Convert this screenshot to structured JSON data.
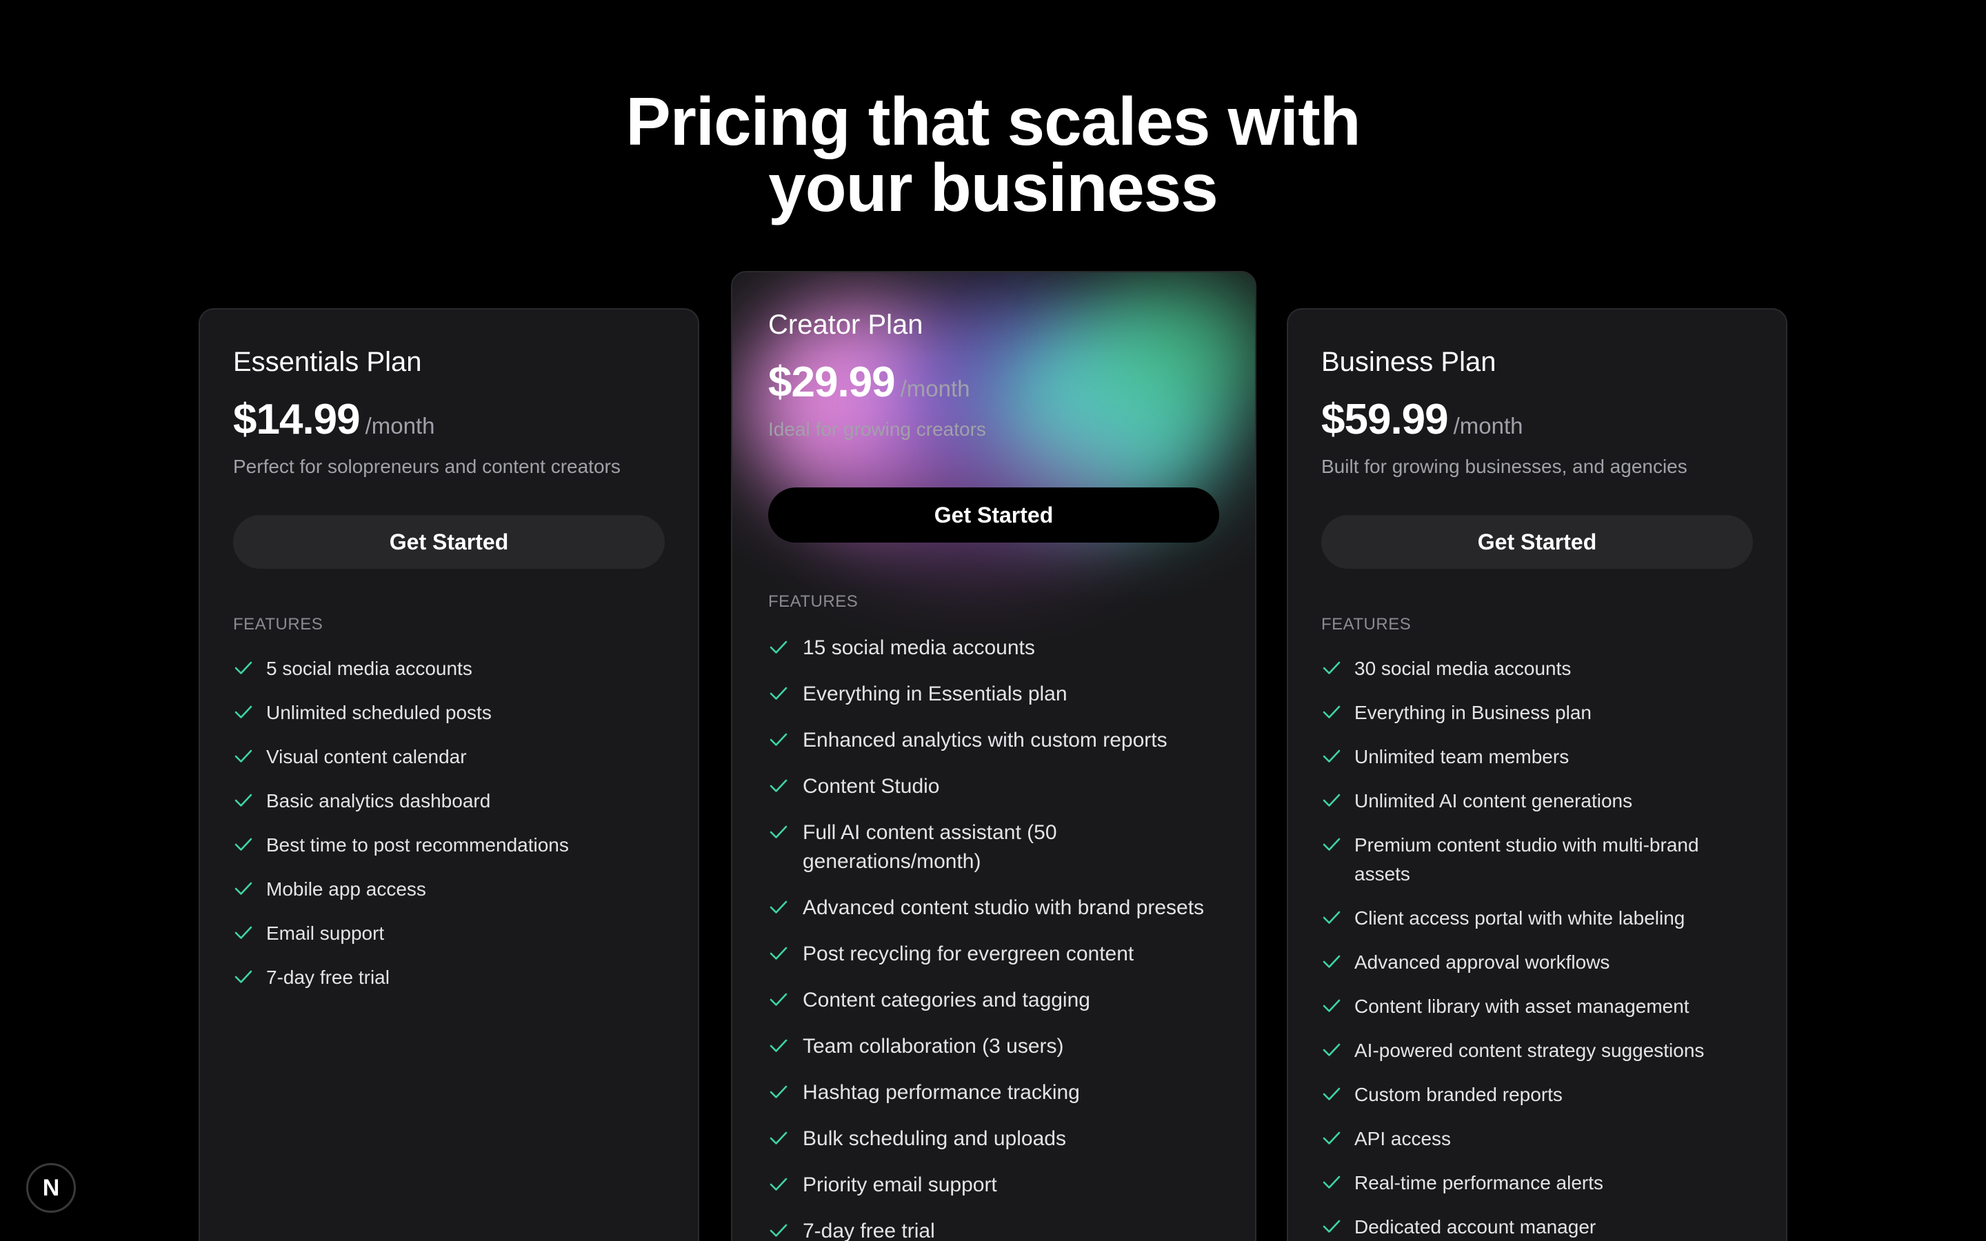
{
  "headline": {
    "line1": "Pricing that scales with",
    "line2": "your business"
  },
  "plans": [
    {
      "name": "Essentials Plan",
      "price": "$14.99",
      "period": "/month",
      "description": "Perfect for solopreneurs and content creators",
      "cta": "Get Started",
      "features_label": "FEATURES",
      "features": [
        "5 social media accounts",
        "Unlimited scheduled posts",
        "Visual content calendar",
        "Basic analytics dashboard",
        "Best time to post recommendations",
        "Mobile app access",
        "Email support",
        "7-day free trial"
      ]
    },
    {
      "name": "Creator Plan",
      "price": "$29.99",
      "period": "/month",
      "description": "Ideal for growing creators",
      "cta": "Get Started",
      "features_label": "FEATURES",
      "features": [
        "15 social media accounts",
        "Everything in Essentials plan",
        "Enhanced analytics with custom reports",
        "Content Studio",
        "Full AI content assistant (50 generations/month)",
        "Advanced content studio with brand presets",
        "Post recycling for evergreen content",
        "Content categories and tagging",
        "Team collaboration (3 users)",
        "Hashtag performance tracking",
        "Bulk scheduling and uploads",
        "Priority email support",
        "7-day free trial"
      ]
    },
    {
      "name": "Business Plan",
      "price": "$59.99",
      "period": "/month",
      "description": "Built for growing businesses, and agencies",
      "cta": "Get Started",
      "features_label": "FEATURES",
      "features": [
        "30 social media accounts",
        "Everything in Business plan",
        "Unlimited team members",
        "Unlimited AI content generations",
        "Premium content studio with multi-brand assets",
        "Client access portal with white labeling",
        "Advanced approval workflows",
        "Content library with asset management",
        "AI-powered content strategy suggestions",
        "Custom branded reports",
        "API access",
        "Real-time performance alerts",
        "Dedicated account manager"
      ]
    }
  ],
  "dev_badge": {
    "letter": "N"
  },
  "colors": {
    "background": "#000000",
    "card": "#19191b",
    "check": "#3fd6a0",
    "muted_text": "#a1a1aa"
  }
}
